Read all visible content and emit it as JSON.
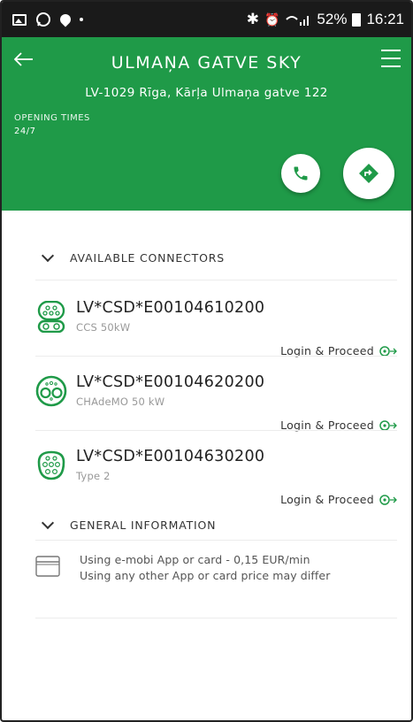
{
  "status_bar": {
    "bluetooth": "✱",
    "alarm": "⏰",
    "battery_level": "52%",
    "time": "16:21"
  },
  "header": {
    "title": "ULMAŅA GATVE SKY",
    "address": "LV-1029 Rīga, Kārļa Ulmaņa gatve 122",
    "opening_label": "OPENING TIMES",
    "opening_value": "24/7",
    "brand_color": "#1f9a48"
  },
  "sections": {
    "connectors_title": "AVAILABLE CONNECTORS",
    "general_title": "GENERAL INFORMATION"
  },
  "connectors": [
    {
      "id": "LV*CSD*E00104610200",
      "type": "CCS 50kW",
      "action": "Login & Proceed",
      "icon": "ccs-plug-icon"
    },
    {
      "id": "LV*CSD*E00104620200",
      "type": "CHAdeMO 50 kW",
      "action": "Login & Proceed",
      "icon": "chademo-plug-icon"
    },
    {
      "id": "LV*CSD*E00104630200",
      "type": "Type 2",
      "action": "Login & Proceed",
      "icon": "type2-plug-icon"
    }
  ],
  "general_info": {
    "line1": "Using e-mobi App or card - 0,15 EUR/min",
    "line2": "Using any other App or card price may differ",
    "icon": "card-icon"
  }
}
